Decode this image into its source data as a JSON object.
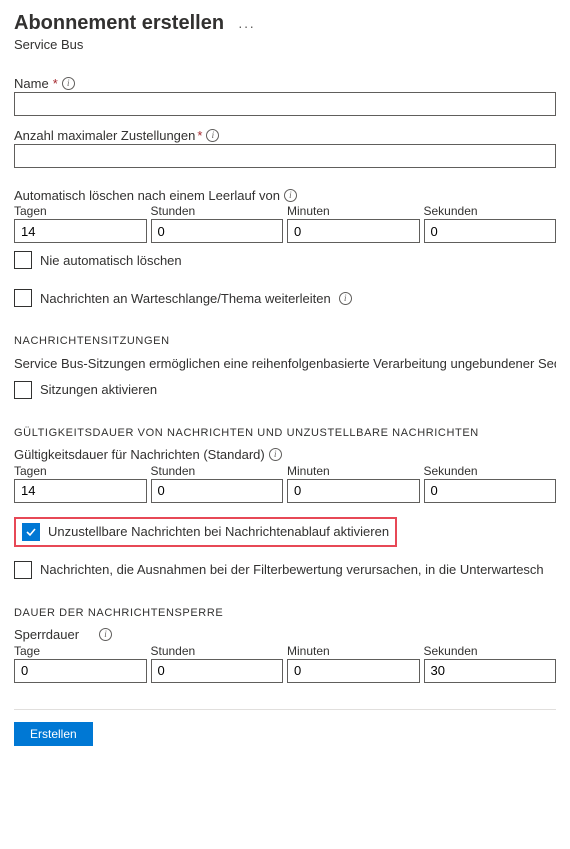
{
  "header": {
    "title": "Abonnement erstellen",
    "subtitle": "Service Bus"
  },
  "name": {
    "label": "Name",
    "value": ""
  },
  "maxDeliveries": {
    "label": "Anzahl maximaler Zustellungen",
    "value": ""
  },
  "autoDelete": {
    "label": "Automatisch löschen nach einem Leerlauf von",
    "units": {
      "days": "Tagen",
      "hours": "Stunden",
      "minutes": "Minuten",
      "seconds": "Sekunden"
    },
    "values": {
      "days": "14",
      "hours": "0",
      "minutes": "0",
      "seconds": "0"
    },
    "neverLabel": "Nie automatisch löschen"
  },
  "forward": {
    "label": "Nachrichten an Warteschlange/Thema weiterleiten"
  },
  "sessions": {
    "heading": "NACHRICHTENSITZUNGEN",
    "description": "Service Bus-Sitzungen ermöglichen eine reihenfolgenbasierte Verarbeitung ungebundener Sequenzen verwandter Nachrichten. Durch die Verwendung des Features der aktivierten Sitzungen kann ein Abonnement die FIFO-Zustellung von Nachrichten garantieren. Weitere",
    "enableLabel": "Sitzungen aktivieren"
  },
  "ttl": {
    "heading": "GÜLTIGKEITSDAUER VON NACHRICHTEN UND UNZUSTELLBARE NACHRICHTEN",
    "label": "Gültigkeitsdauer für Nachrichten (Standard)",
    "units": {
      "days": "Tagen",
      "hours": "Stunden",
      "minutes": "Minuten",
      "seconds": "Sekunden"
    },
    "values": {
      "days": "14",
      "hours": "0",
      "minutes": "0",
      "seconds": "0"
    },
    "deadLetterLabel": "Unzustellbare Nachrichten bei Nachrichtenablauf aktivieren",
    "filterExceptionLabel": "Nachrichten, die Ausnahmen bei der Filterbewertung verursachen, in die Unterwartesch"
  },
  "lock": {
    "heading": "DAUER DER NACHRICHTENSPERRE",
    "label": "Sperrdauer",
    "units": {
      "days": "Tage",
      "hours": "Stunden",
      "minutes": "Minuten",
      "seconds": "Sekunden"
    },
    "values": {
      "days": "0",
      "hours": "0",
      "minutes": "0",
      "seconds": "30"
    }
  },
  "footer": {
    "create": "Erstellen"
  }
}
